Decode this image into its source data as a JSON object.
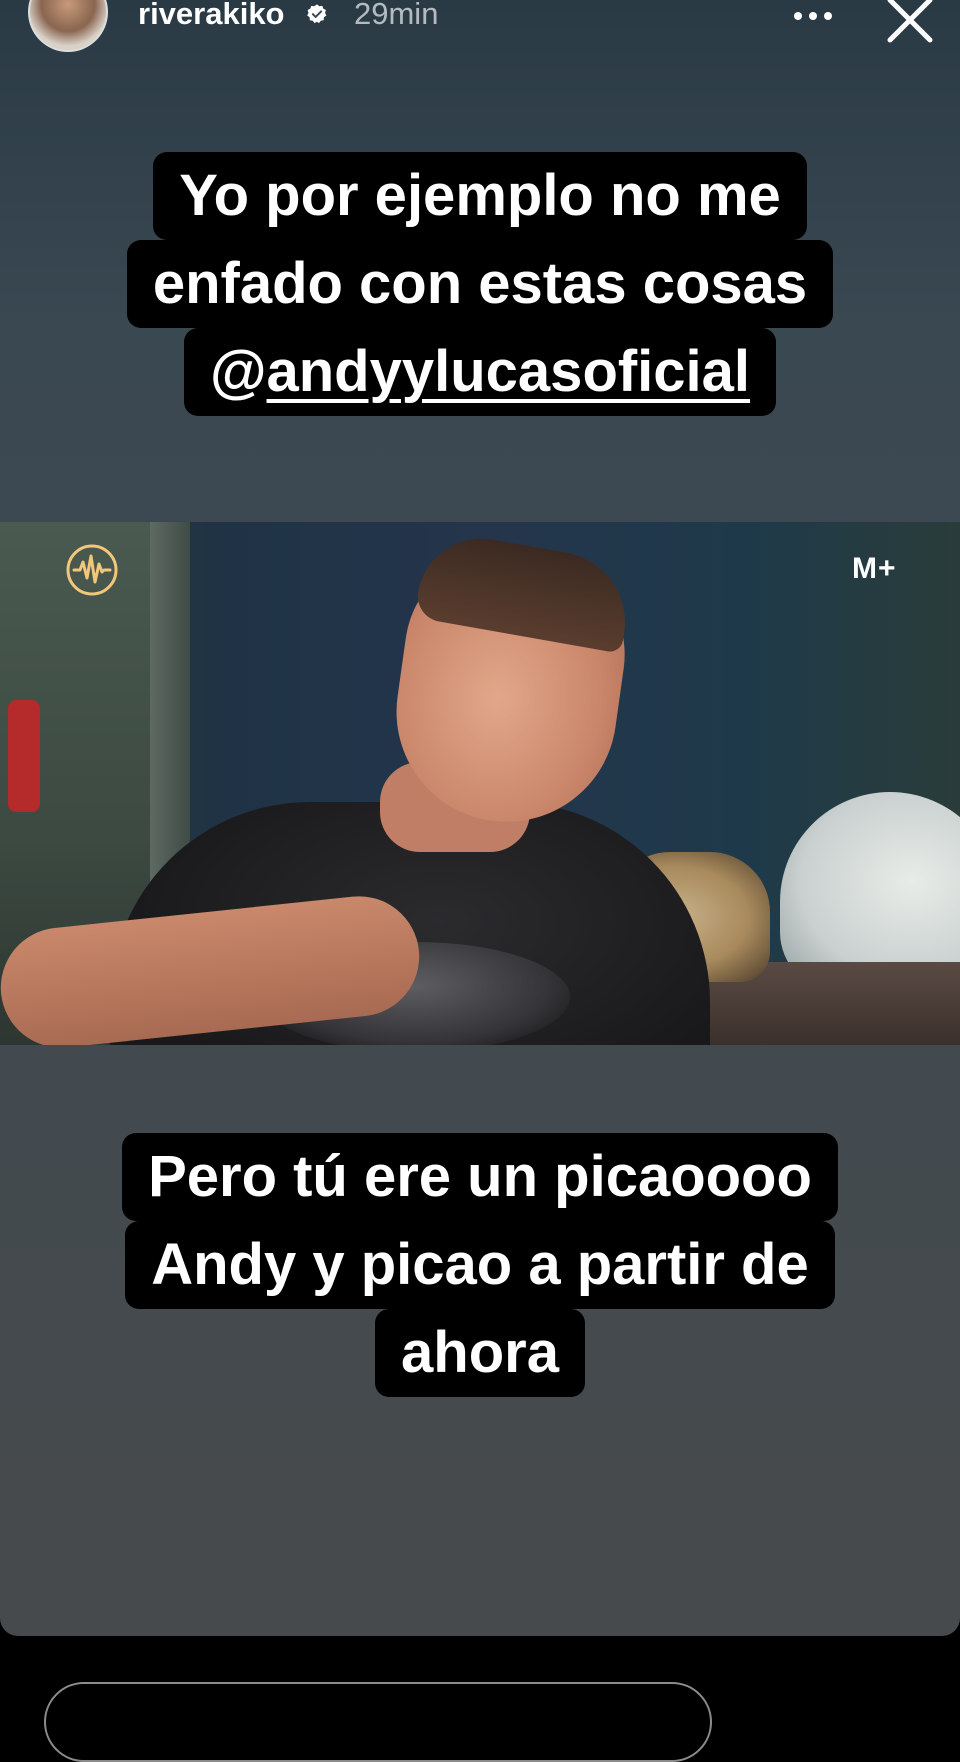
{
  "header": {
    "username": "riverakiko",
    "time": "29min",
    "verified_icon": "verified-badge-icon",
    "more_icon": "more-dots-icon",
    "close_icon": "close-icon"
  },
  "story": {
    "top_caption": {
      "line1": "Yo por ejemplo no me",
      "line2": "enfado con estas cosas",
      "mention_prefix": "@",
      "mention": "andyylucasoficial"
    },
    "video": {
      "channel_logo": "radio-wave-logo",
      "brand_logo": "M+"
    },
    "bottom_caption": {
      "line1": "Pero tú ere un picaoooo",
      "line2": "Andy y picao a partir de",
      "line3": "ahora"
    }
  },
  "colors": {
    "caption_bg": "#000000",
    "caption_text": "#ffffff",
    "story_bg": "#3f4a50"
  }
}
